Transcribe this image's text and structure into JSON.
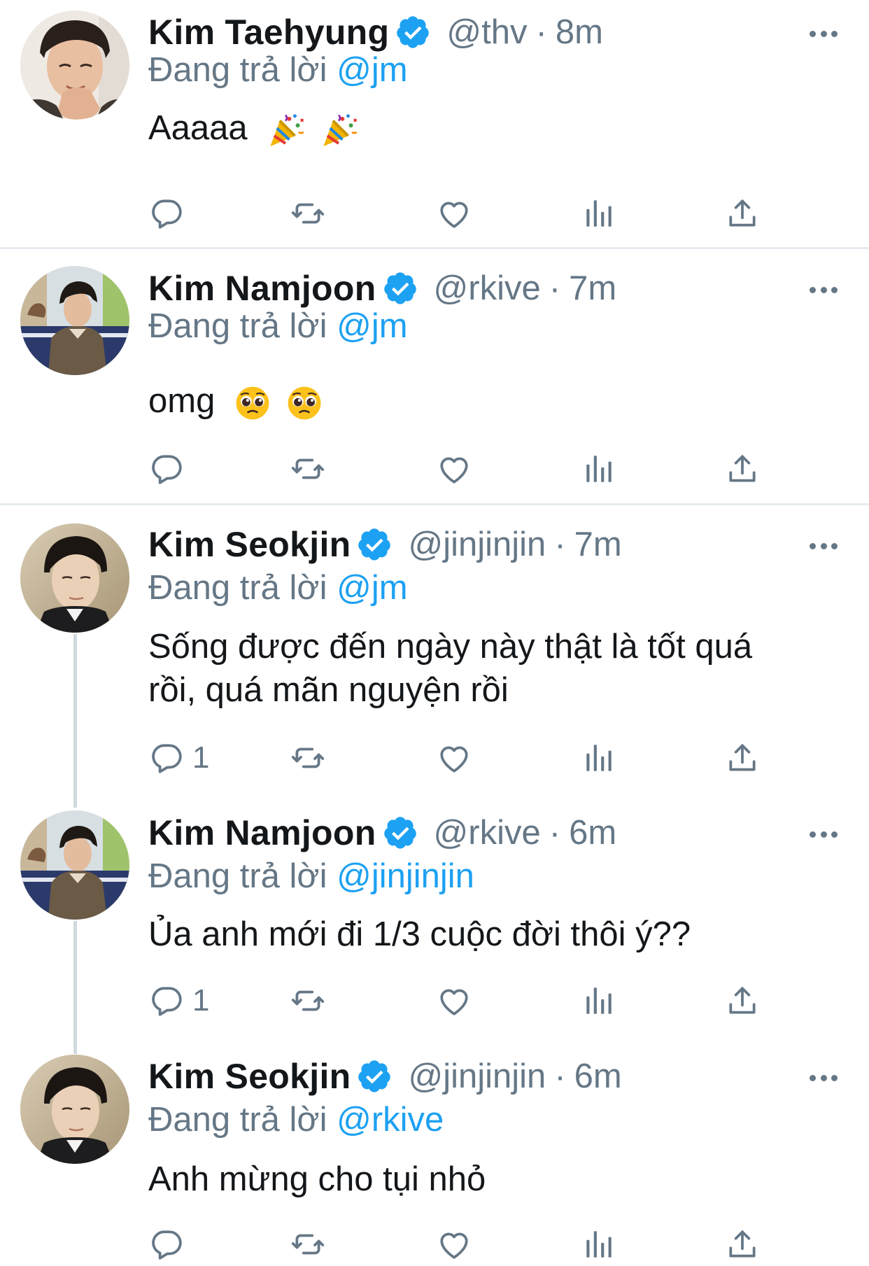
{
  "tweets": [
    {
      "name": "Kim Taehyung",
      "handle": "@thv",
      "time": "8m",
      "reply_label": "Đang trả lời",
      "reply_handle": "@jm",
      "text": "Aaaaa",
      "emoji": [
        "party-popper",
        "party-popper"
      ],
      "reply_count": ""
    },
    {
      "name": "Kim Namjoon",
      "handle": "@rkive",
      "time": "7m",
      "reply_label": "Đang trả lời",
      "reply_handle": "@jm",
      "text": "omg",
      "emoji": [
        "pleading-face",
        "pleading-face"
      ],
      "reply_count": ""
    },
    {
      "name": "Kim Seokjin",
      "handle": "@jinjinjin",
      "time": "7m",
      "reply_label": "Đang trả lời",
      "reply_handle": "@jm",
      "text_line1": "Sống được đến ngày này thật là tốt quá",
      "text_line2": "rồi, quá mãn nguyện rồi",
      "reply_count": "1"
    },
    {
      "name": "Kim Namjoon",
      "handle": "@rkive",
      "time": "6m",
      "reply_label": "Đang trả lời",
      "reply_handle": "@jinjinjin",
      "text": "Ủa anh mới đi 1/3 cuộc đời thôi ý??",
      "reply_count": "1"
    },
    {
      "name": "Kim Seokjin",
      "handle": "@jinjinjin",
      "time": "6m",
      "reply_label": "Đang trả lời",
      "reply_handle": "@rkive",
      "text": "Anh mừng cho tụi nhỏ",
      "reply_count": ""
    }
  ],
  "separator": "·",
  "colors": {
    "text": "#14171a",
    "secondary": "#657786",
    "link": "#1da1f2",
    "verified": "#1da1f2",
    "divider": "#e6ecf0",
    "thread_line": "#cfd9de"
  },
  "icons": [
    "verified-badge-icon",
    "more-icon",
    "reply-icon",
    "retweet-icon",
    "like-icon",
    "analytics-icon",
    "share-icon"
  ]
}
